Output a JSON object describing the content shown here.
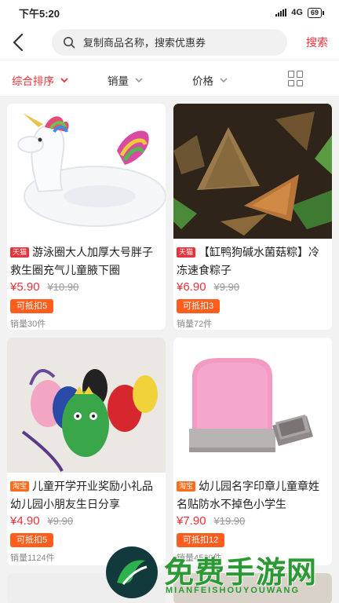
{
  "status_bar": {
    "time": "下午5:20",
    "network": "4G",
    "battery": "69"
  },
  "search": {
    "placeholder": "复制商品名称，搜索优惠券",
    "button_label": "搜索"
  },
  "sort_bar": {
    "items": [
      "综合排序",
      "销量",
      "价格"
    ],
    "active_index": 0,
    "accent_color": "#e8313a"
  },
  "products": [
    {
      "platform": "天猫",
      "title": "游泳圈大人加厚大号胖子救生圈充气儿童腋下圈",
      "price": "¥5.90",
      "original_price": "¥10.90",
      "coupon": "可抵扣5",
      "sold": "销量30件",
      "image": "unicorn-swim-ring"
    },
    {
      "platform": "天猫",
      "title": "【缸鸭狗碱水菌菇粽】冷冻速食粽子",
      "price": "¥6.90",
      "original_price": "¥9.90",
      "coupon": "可抵扣3",
      "sold": "销量72件",
      "image": "zongzi-rice-dumplings"
    },
    {
      "platform": "淘宝",
      "title": "儿童开学开业奖励小礼品幼儿园小朋友生日分享",
      "price": "¥4.90",
      "original_price": "¥9.90",
      "coupon": "可抵扣5",
      "sold": "销量1124件",
      "image": "kids-dinosaur-bags"
    },
    {
      "platform": "淘宝",
      "title": "幼儿园名字印章儿童章姓名贴防水不掉色小学生",
      "price": "¥7.90",
      "original_price": "¥19.90",
      "coupon": "可抵扣12",
      "sold": "销量4560件",
      "image": "pink-name-stamp"
    }
  ],
  "watermark": {
    "text": "免费手游网",
    "subtext": "MIANFEISHOUYOUWANG"
  }
}
